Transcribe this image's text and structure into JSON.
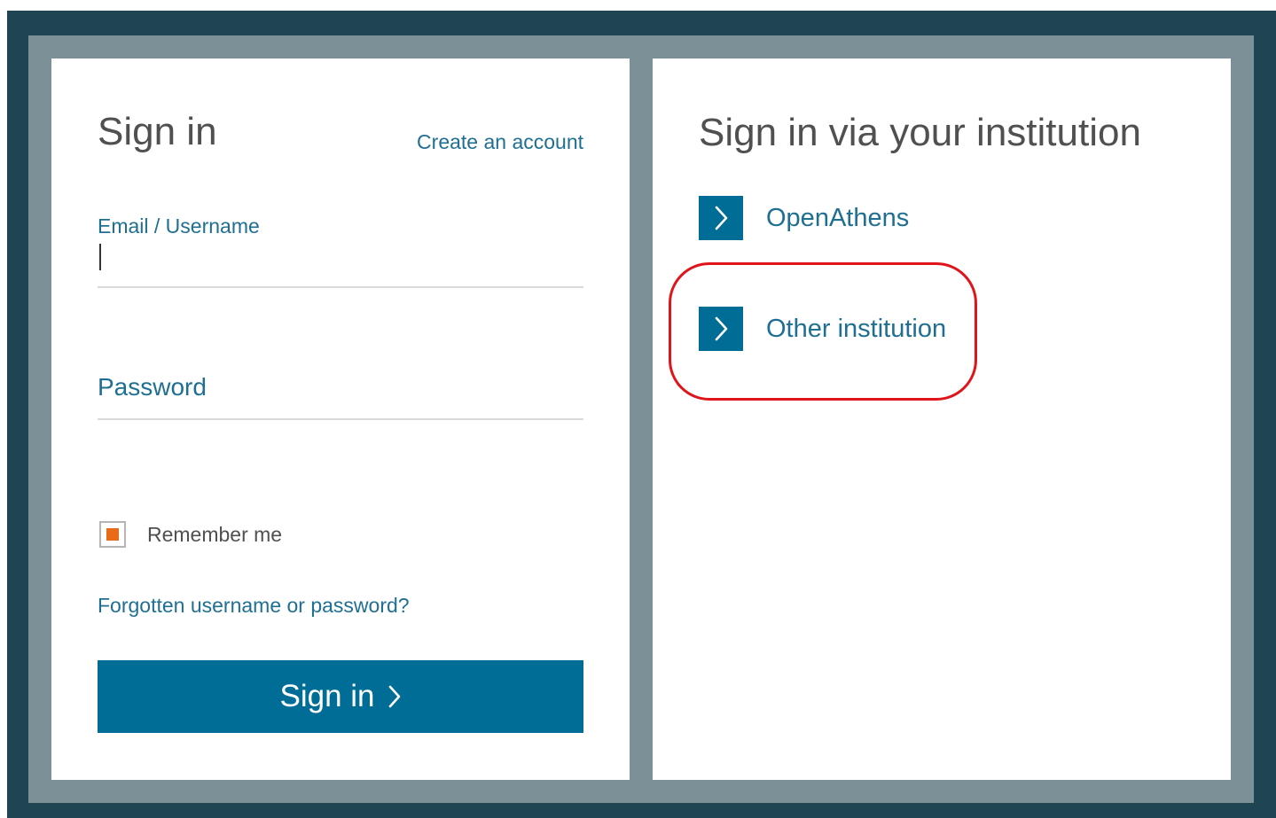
{
  "sign_in_panel": {
    "title": "Sign in",
    "create_account_link": "Create an account",
    "email_label": "Email / Username",
    "email_value": "",
    "password_label": "Password",
    "password_value": "",
    "remember_me_label": "Remember me",
    "remember_me_checked": true,
    "forgot_link": "Forgotten username or password?",
    "submit_button_label": "Sign in",
    "submit_icon": "chevron-right-icon"
  },
  "institution_panel": {
    "title": "Sign in via your institution",
    "options": [
      {
        "label": "OpenAthens",
        "icon": "chevron-right-icon"
      },
      {
        "label": "Other institution",
        "icon": "chevron-right-icon",
        "highlighted": true
      }
    ]
  },
  "colors": {
    "outer_border": "#1f4552",
    "inner_border": "#7c9097",
    "brand_blue": "#006d96",
    "link_blue": "#1f6f93",
    "heading_gray": "#505050",
    "checkbox_accent": "#ea6b17",
    "highlight_red": "#e0141b"
  }
}
